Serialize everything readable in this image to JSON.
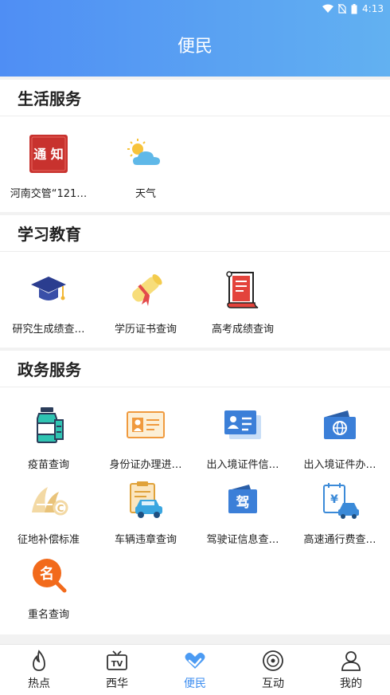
{
  "status": {
    "time": "4:13"
  },
  "header": {
    "title": "便民"
  },
  "sections": [
    {
      "title": "生活服务",
      "items": [
        {
          "label": "河南交管“121…",
          "icon": "notice-icon",
          "icon_text": "通 知"
        },
        {
          "label": "天气",
          "icon": "weather-icon"
        }
      ]
    },
    {
      "title": "学习教育",
      "items": [
        {
          "label": "研究生成绩查…",
          "icon": "graduation-cap-icon"
        },
        {
          "label": "学历证书查询",
          "icon": "diploma-scroll-icon"
        },
        {
          "label": "高考成绩查询",
          "icon": "exam-scroll-icon"
        }
      ]
    },
    {
      "title": "政务服务",
      "items": [
        {
          "label": "疫苗查询",
          "icon": "vaccine-bottle-icon"
        },
        {
          "label": "身份证办理进…",
          "icon": "id-card-icon"
        },
        {
          "label": "出入境证件信…",
          "icon": "certificate-card-icon"
        },
        {
          "label": "出入境证件办…",
          "icon": "passport-icon"
        },
        {
          "label": "征地补偿标准",
          "icon": "land-compensation-icon"
        },
        {
          "label": "车辆违章查询",
          "icon": "car-violation-icon"
        },
        {
          "label": "驾驶证信息查…",
          "icon": "driver-license-icon",
          "icon_text": "驾"
        },
        {
          "label": "高速通行费查…",
          "icon": "toll-fee-icon"
        },
        {
          "label": "重名查询",
          "icon": "name-search-icon",
          "icon_text": "名"
        }
      ]
    }
  ],
  "tabbar": [
    {
      "label": "热点",
      "icon": "flame-icon",
      "active": false
    },
    {
      "label": "西华",
      "icon": "tv-icon",
      "active": false
    },
    {
      "label": "便民",
      "icon": "heart-hand-icon",
      "active": true
    },
    {
      "label": "互动",
      "icon": "disc-icon",
      "active": false
    },
    {
      "label": "我的",
      "icon": "user-icon",
      "active": false
    }
  ],
  "colors": {
    "accent": "#3d8ef0",
    "header_start": "#4f8ef4",
    "header_end": "#62b1f1"
  }
}
